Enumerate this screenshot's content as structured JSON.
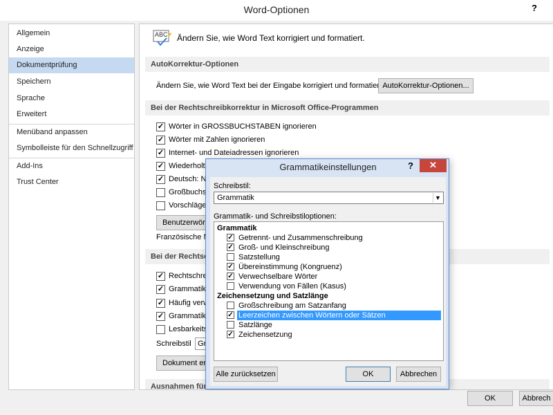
{
  "window": {
    "title": "Word-Optionen",
    "help": "?"
  },
  "sidebar": {
    "items": [
      "Allgemein",
      "Anzeige",
      "Dokumentprüfung",
      "Speichern",
      "Sprache",
      "Erweitert",
      "Menüband anpassen",
      "Symbolleiste für den Schnellzugriff",
      "Add-Ins",
      "Trust Center"
    ],
    "selected": "Dokumentprüfung"
  },
  "content": {
    "intro": "Ändern Sie, wie Word Text korrigiert und formatiert.",
    "icon_label": "ABC",
    "autocorrect": {
      "heading": "AutoKorrektur-Optionen",
      "text": "Ändern Sie, wie Word Text bei der Eingabe korrigiert und formatiert:",
      "button": "AutoKorrektur-Optionen..."
    },
    "office_spelling": {
      "heading": "Bei der Rechtschreibkorrektur in Microsoft Office-Programmen",
      "options": [
        {
          "label": "Wörter in GROSSBUCHSTABEN ignorieren",
          "checked": true
        },
        {
          "label": "Wörter mit Zahlen ignorieren",
          "checked": true
        },
        {
          "label": "Internet- und Dateiadressen ignorieren",
          "checked": true
        },
        {
          "label": "Wiederholte",
          "checked": true
        },
        {
          "label": "Deutsch: Ne",
          "checked": true
        },
        {
          "label": "Großbuchst",
          "checked": false
        },
        {
          "label": "Vorschläge",
          "checked": false
        }
      ],
      "custom_button": "Benutzerwört",
      "french": "Französische M"
    },
    "word_spelling": {
      "heading": "Bei der Rechtsch",
      "options": [
        {
          "label": "Rechtschrei",
          "checked": true
        },
        {
          "label": "Grammatikf",
          "checked": true
        },
        {
          "label": "Häufig verw",
          "checked": true
        },
        {
          "label": "Grammatik",
          "checked": true
        },
        {
          "label": "Lesbarkeits",
          "checked": false
        }
      ],
      "style_label": "Schreibstil",
      "style_value": "Gr",
      "doc_button": "Dokument er"
    },
    "exceptions_heading": "Ausnahmen für"
  },
  "dialog": {
    "title": "Grammatikeinstellungen",
    "help": "?",
    "close": "✕",
    "style_label": "Schreibstil:",
    "style_value": "Grammatik",
    "options_label": "Grammatik- und Schreibstiloptionen:",
    "groups": [
      {
        "name": "Grammatik",
        "items": [
          {
            "label": "Getrennt- und Zusammenschreibung",
            "checked": true
          },
          {
            "label": "Groß- und Kleinschreibung",
            "checked": true
          },
          {
            "label": "Satzstellung",
            "checked": false
          },
          {
            "label": "Übereinstimmung (Kongruenz)",
            "checked": true
          },
          {
            "label": "Verwechselbare Wörter",
            "checked": true
          },
          {
            "label": "Verwendung von Fällen (Kasus)",
            "checked": false
          }
        ]
      },
      {
        "name": "Zeichensetzung und Satzlänge",
        "items": [
          {
            "label": "Großschreibung am Satzanfang",
            "checked": false
          },
          {
            "label": "Leerzeichen zwischen Wörtern oder Sätzen",
            "checked": true,
            "highlighted": true
          },
          {
            "label": "Satzlänge",
            "checked": false
          },
          {
            "label": "Zeichensetzung",
            "checked": true
          }
        ]
      }
    ],
    "reset_button": "Alle zurücksetzen",
    "ok_button": "OK",
    "cancel_button": "Abbrechen"
  },
  "footer": {
    "ok": "OK",
    "cancel": "Abbrech"
  },
  "colors": {
    "selection": "#c5d9f1",
    "highlight": "#3399ff",
    "close": "#c7463c",
    "dialog_frame": "#d8e4f4"
  }
}
